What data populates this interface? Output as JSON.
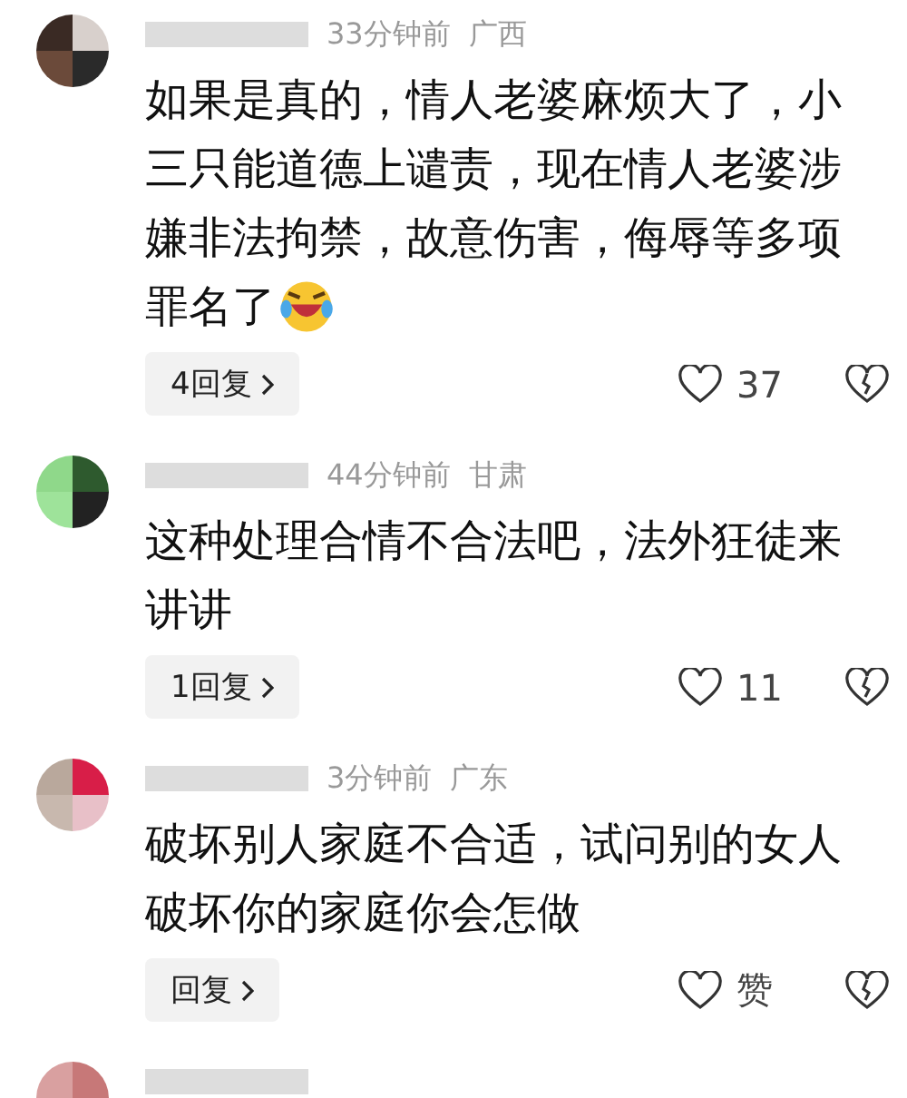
{
  "comments": [
    {
      "kind": "full",
      "time": "33分钟前",
      "region": "广西",
      "lines": [
        "如果是真的，情人老婆麻烦大了，小",
        "三只能道德上谴责，现在情人老婆涉",
        "嫌非法拘禁，故意伤害，侮辱等多项",
        "罪名了"
      ],
      "emoji": true,
      "reply_label": "4回复",
      "likes": "37"
    },
    {
      "kind": "full",
      "time": "44分钟前",
      "region": "甘肃",
      "lines": [
        "这种处理合情不合法吧，法外狂徒来",
        "讲讲"
      ],
      "reply_label": "1回复",
      "likes": "11"
    },
    {
      "kind": "full",
      "time": "3分钟前",
      "region": "广东",
      "lines": [
        "破坏别人家庭不合适，试问别的女人",
        "破坏你的家庭你会怎做"
      ],
      "reply_label": "回复",
      "likes": "赞"
    },
    {
      "kind": "partial"
    }
  ]
}
